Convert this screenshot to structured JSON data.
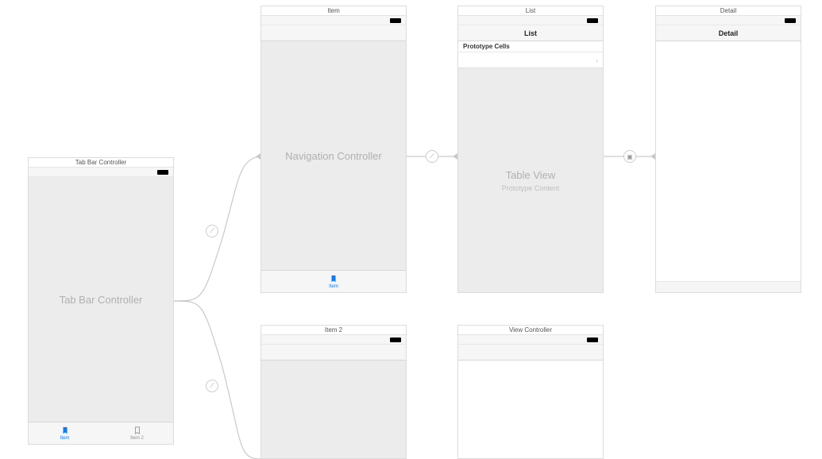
{
  "scenes": {
    "tabbar": {
      "header": "Tab Bar Controller",
      "placeholder": "Tab Bar Controller",
      "tabs": [
        {
          "label": "Item",
          "active": true
        },
        {
          "label": "Item 2",
          "active": false
        }
      ]
    },
    "item": {
      "header": "Item",
      "placeholder": "Navigation Controller",
      "tab_label": "Item"
    },
    "list": {
      "header": "List",
      "nav_title": "List",
      "proto_header": "Prototype Cells",
      "table_title": "Table View",
      "table_sub": "Prototype Content"
    },
    "detail": {
      "header": "Detail",
      "nav_title": "Detail"
    },
    "item2": {
      "header": "Item 2"
    },
    "vc": {
      "header": "View Controller"
    }
  },
  "segue_icons": {
    "relationship_1": "⟋",
    "link": "⟋",
    "root": "⟋",
    "show": "▣",
    "relationship_2": "⟋"
  }
}
